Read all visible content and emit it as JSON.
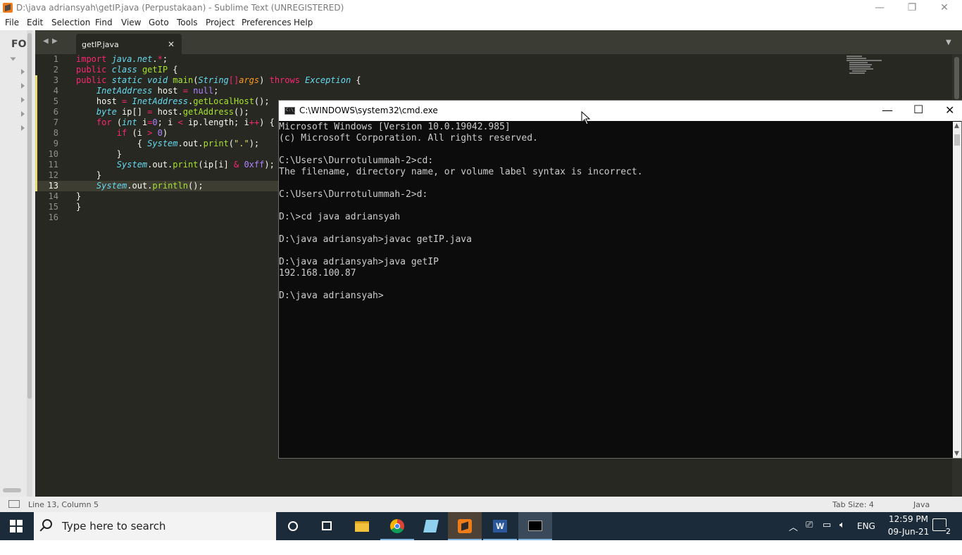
{
  "window": {
    "title": "D:\\java adriansyah\\getIP.java (Perpustakaan) - Sublime Text (UNREGISTERED)",
    "minimize": "—",
    "restore": "❐",
    "close": "✕"
  },
  "menu": [
    {
      "label": "File"
    },
    {
      "label": "Edit"
    },
    {
      "label": "Selection"
    },
    {
      "label": "Find"
    },
    {
      "label": "View"
    },
    {
      "label": "Goto"
    },
    {
      "label": "Tools"
    },
    {
      "label": "Project"
    },
    {
      "label": "Preferences"
    },
    {
      "label": "Help"
    }
  ],
  "sidebar": {
    "folders_label": "FOI"
  },
  "tabs": {
    "active": "getIP.java",
    "close": "✕",
    "nav_left": "◀",
    "nav_right": "▶",
    "dropdown": "▼"
  },
  "editor": {
    "line_numbers": [
      "1",
      "2",
      "3",
      "4",
      "5",
      "6",
      "7",
      "8",
      "9",
      "10",
      "11",
      "12",
      "13",
      "14",
      "15",
      "16"
    ],
    "current_line": "13"
  },
  "cmd": {
    "title": "C:\\WINDOWS\\system32\\cmd.exe",
    "lines": [
      "Microsoft Windows [Version 10.0.19042.985]",
      "(c) Microsoft Corporation. All rights reserved.",
      "",
      "C:\\Users\\Durrotulummah-2>cd:",
      "The filename, directory name, or volume label syntax is incorrect.",
      "",
      "C:\\Users\\Durrotulummah-2>d:",
      "",
      "D:\\>cd java adriansyah",
      "",
      "D:\\java adriansyah>javac getIP.java",
      "",
      "D:\\java adriansyah>java getIP",
      "192.168.100.87",
      "",
      "D:\\java adriansyah>"
    ]
  },
  "status": {
    "position": "Line 13, Column 5",
    "tab_size": "Tab Size: 4",
    "syntax": "Java"
  },
  "taskbar": {
    "search_placeholder": "Type here to search",
    "language": "ENG",
    "time": "12:59 PM",
    "date": "09-Jun-21",
    "notifications": "2"
  }
}
